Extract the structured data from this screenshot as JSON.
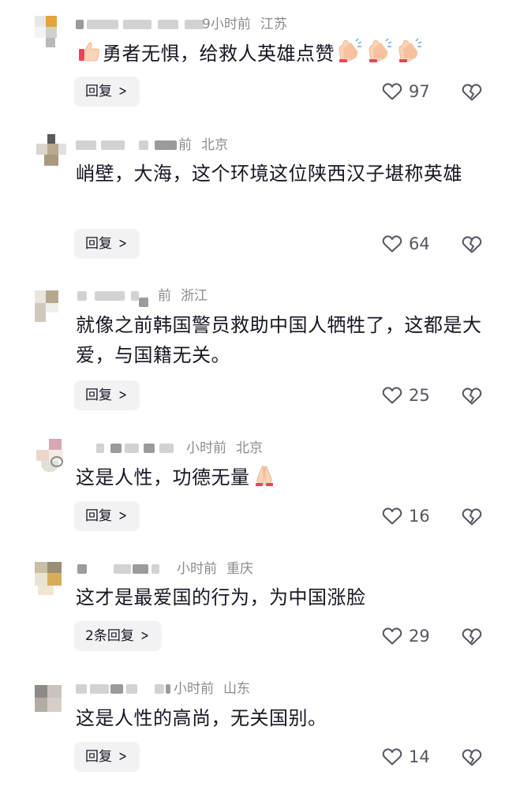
{
  "comments": [
    {
      "time": "9小时前",
      "location": "江苏",
      "text": "勇者无惧，给救人英雄点赞",
      "reply_label": "回复",
      "likes": "97"
    },
    {
      "time": "前",
      "location": "北京",
      "text": "峭壁，大海，这个环境这位陕西汉子堪称英雄",
      "reply_label": "回复",
      "likes": "64"
    },
    {
      "time": "前",
      "location": "浙江",
      "text": "就像之前韩国警员救助中国人牺牲了，这都是大爱，与国籍无关。",
      "reply_label": "回复",
      "likes": "25"
    },
    {
      "time": "小时前",
      "location": "北京",
      "text": "这是人性，功德无量",
      "reply_label": "回复",
      "likes": "16"
    },
    {
      "time": "小时前",
      "location": "重庆",
      "text": "这才是最爱国的行为，为中国涨脸",
      "reply_label": "2条回复",
      "likes": "29"
    },
    {
      "time": "小时前",
      "location": "山东",
      "text": "这是人性的高尚，无关国别。",
      "reply_label": "回复",
      "likes": "14"
    }
  ],
  "icons": {
    "like": "heart-outline-icon",
    "dislike": "broken-heart-icon",
    "reply_chevron": "chevron-right-icon"
  },
  "colors": {
    "text": "#161823",
    "meta": "#8a8b91",
    "count": "#555660",
    "reply_bg": "#f2f2f4"
  }
}
